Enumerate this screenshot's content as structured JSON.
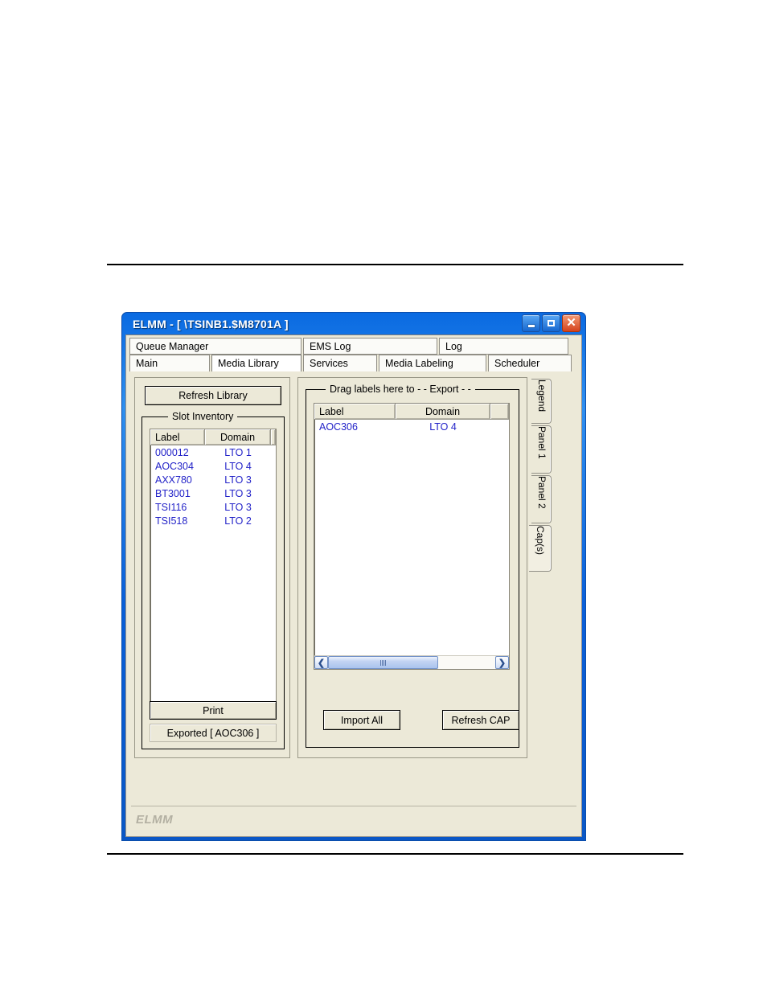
{
  "window": {
    "title": "ELMM - [ \\TSINB1.$M8701A ]",
    "controls": {
      "minimize": "minimize-button",
      "maximize": "maximize-button",
      "close": "close-button"
    },
    "status_text": "ELMM",
    "frame_color": "#0a5fd8",
    "client_color": "#ece9d8"
  },
  "tabs": {
    "row1": [
      {
        "label": "Queue Manager",
        "selected": false
      },
      {
        "label": "EMS Log",
        "selected": false
      },
      {
        "label": "Log",
        "selected": false
      }
    ],
    "row2": [
      {
        "label": "Main",
        "selected": false
      },
      {
        "label": "Media Library",
        "selected": true
      },
      {
        "label": "Services",
        "selected": false
      },
      {
        "label": "Media Labeling",
        "selected": false
      },
      {
        "label": "Scheduler",
        "selected": false
      }
    ]
  },
  "left_panel": {
    "refresh_button": "Refresh Library",
    "group_title": "Slot Inventory",
    "columns": [
      "Label",
      "Domain",
      ""
    ],
    "rows": [
      {
        "label": "000012",
        "domain": "LTO 1",
        "extra": ""
      },
      {
        "label": "AOC304",
        "domain": "LTO 4",
        "extra": ""
      },
      {
        "label": "AXX780",
        "domain": "LTO 3",
        "extra": ""
      },
      {
        "label": "BT3001",
        "domain": "LTO 3",
        "extra": ""
      },
      {
        "label": "TSI116",
        "domain": "LTO 3",
        "extra": ""
      },
      {
        "label": "TSI518",
        "domain": "LTO 2",
        "extra": ""
      }
    ],
    "print_button": "Print",
    "exported_status": "Exported [ AOC306 ]",
    "text_color": "#2222c8"
  },
  "right_panel": {
    "group_title": "Drag labels here to  - - Export - -",
    "columns": [
      "Label",
      "Domain",
      ""
    ],
    "rows": [
      {
        "label": "AOC306",
        "domain": "LTO 4",
        "extra": ""
      }
    ],
    "import_button": "Import All",
    "refresh_cap_button": "Refresh CAP"
  },
  "vertical_tabs": [
    {
      "label": "Legend",
      "selected": false
    },
    {
      "label": "Panel 1",
      "selected": false
    },
    {
      "label": "Panel 2",
      "selected": false
    },
    {
      "label": "Cap(s)",
      "selected": true
    }
  ],
  "scrollbars": {
    "left_arrow": "❮",
    "right_arrow": "❯"
  }
}
